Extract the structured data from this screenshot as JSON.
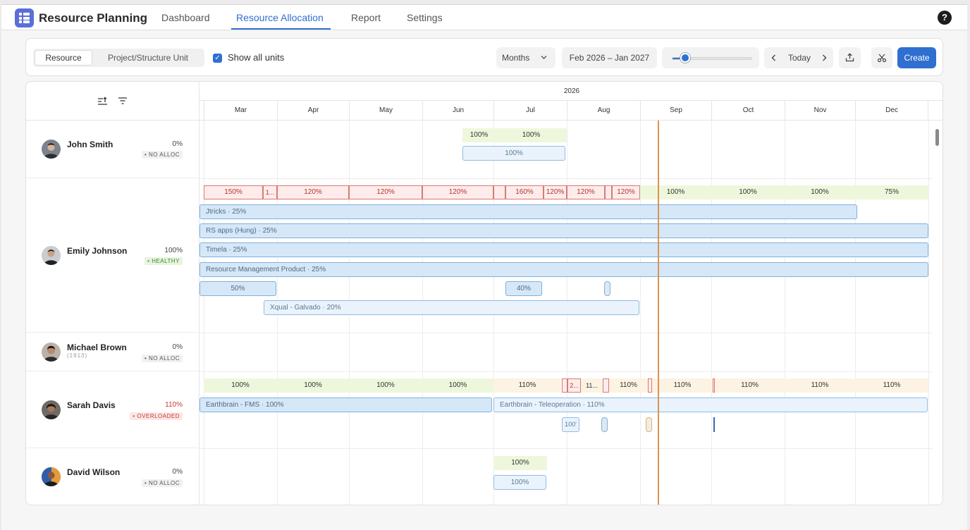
{
  "app": {
    "title": "Resource Planning"
  },
  "nav": {
    "tabs": [
      "Dashboard",
      "Resource Allocation",
      "Report",
      "Settings"
    ],
    "active": "Resource Allocation"
  },
  "toolbar": {
    "view_toggle": [
      "Resource",
      "Project/Structure Unit"
    ],
    "active_view": "Resource",
    "show_all_units": {
      "label": "Show all units",
      "checked": true
    },
    "period_select": "Months",
    "date_range": "Feb 2026 – Jan 2027",
    "zoom_level": 0.2,
    "today_label": "Today",
    "create_label": "Create"
  },
  "timeline": {
    "year": "2026",
    "months": [
      "Mar",
      "Apr",
      "May",
      "Jun",
      "Jul",
      "Aug",
      "Sep",
      "Oct",
      "Nov",
      "Dec"
    ]
  },
  "resources": [
    {
      "name": "John Smith",
      "percent": "0%",
      "status": "• NO ALLOC",
      "summary": [
        "100%",
        "100%"
      ],
      "bars": [
        "100%"
      ]
    },
    {
      "name": "Emily Johnson",
      "percent": "100%",
      "status": "• HEALTHY",
      "summary": [
        "150%",
        "1...",
        "120%",
        "120%",
        "120%",
        "160%",
        "120%",
        "120%",
        "120%",
        "100%",
        "100%",
        "100%",
        "75%"
      ],
      "bars": [
        {
          "project": "Jtricks",
          "pct": "25%"
        },
        {
          "project": "RS apps (Hung)",
          "pct": "25%"
        },
        {
          "project": "Timela",
          "pct": "25%"
        },
        {
          "project": "Resource Management Product",
          "pct": "25%"
        },
        {
          "project": "",
          "pct": "50%"
        },
        {
          "project": "",
          "pct": "40%"
        },
        {
          "project": "Xqual - Galvado",
          "pct": "20%"
        }
      ]
    },
    {
      "name": "Michael Brown",
      "percent": "0%",
      "status": "• NO ALLOC",
      "sub_id": "(1913)"
    },
    {
      "name": "Sarah Davis",
      "percent": "110%",
      "status": "• OVERLOADED",
      "summary": [
        "100%",
        "100%",
        "100%",
        "100%",
        "110%",
        "2...",
        "11...",
        "110%",
        "110%",
        "110%",
        "110%",
        "110%"
      ],
      "bars": [
        {
          "project": "Earthbrain - FMS",
          "pct": "100%"
        },
        {
          "project": "Earthbrain - Teleoperation",
          "pct": "110%"
        },
        {
          "project": "",
          "pct": "100'"
        }
      ]
    },
    {
      "name": "David Wilson",
      "percent": "0%",
      "status": "• NO ALLOC",
      "summary": [
        "100%"
      ],
      "bars": [
        "100%"
      ]
    }
  ],
  "colors": {
    "accent": "#2f6fd0",
    "overloaded": "#c53a2f",
    "healthy": "#3a8a2f",
    "today_line": "#d9944f"
  }
}
